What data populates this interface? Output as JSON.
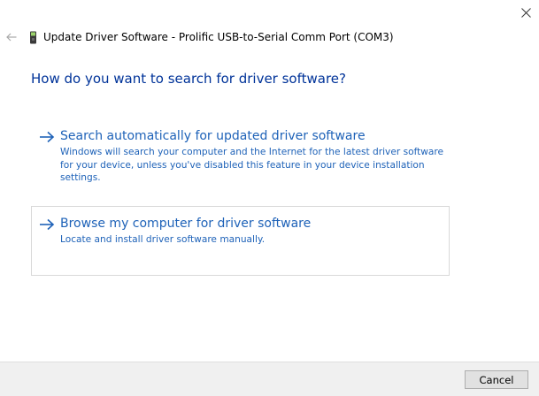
{
  "window": {
    "title": "Update Driver Software - Prolific USB-to-Serial Comm Port (COM3)",
    "back_icon": "back-arrow-icon",
    "device_icon": "usb-device-icon",
    "close_icon": "close-icon"
  },
  "main": {
    "heading": "How do you want to search for driver software?",
    "options": [
      {
        "title": "Search automatically for updated driver software",
        "description": "Windows will search your computer and the Internet for the latest driver software for your device, unless you've disabled this feature in your device installation settings."
      },
      {
        "title": "Browse my computer for driver software",
        "description": "Locate and install driver software manually."
      }
    ]
  },
  "footer": {
    "cancel_label": "Cancel"
  },
  "colors": {
    "heading": "#003399",
    "link": "#1e62b8",
    "footer_bg": "#f0f0f0"
  }
}
